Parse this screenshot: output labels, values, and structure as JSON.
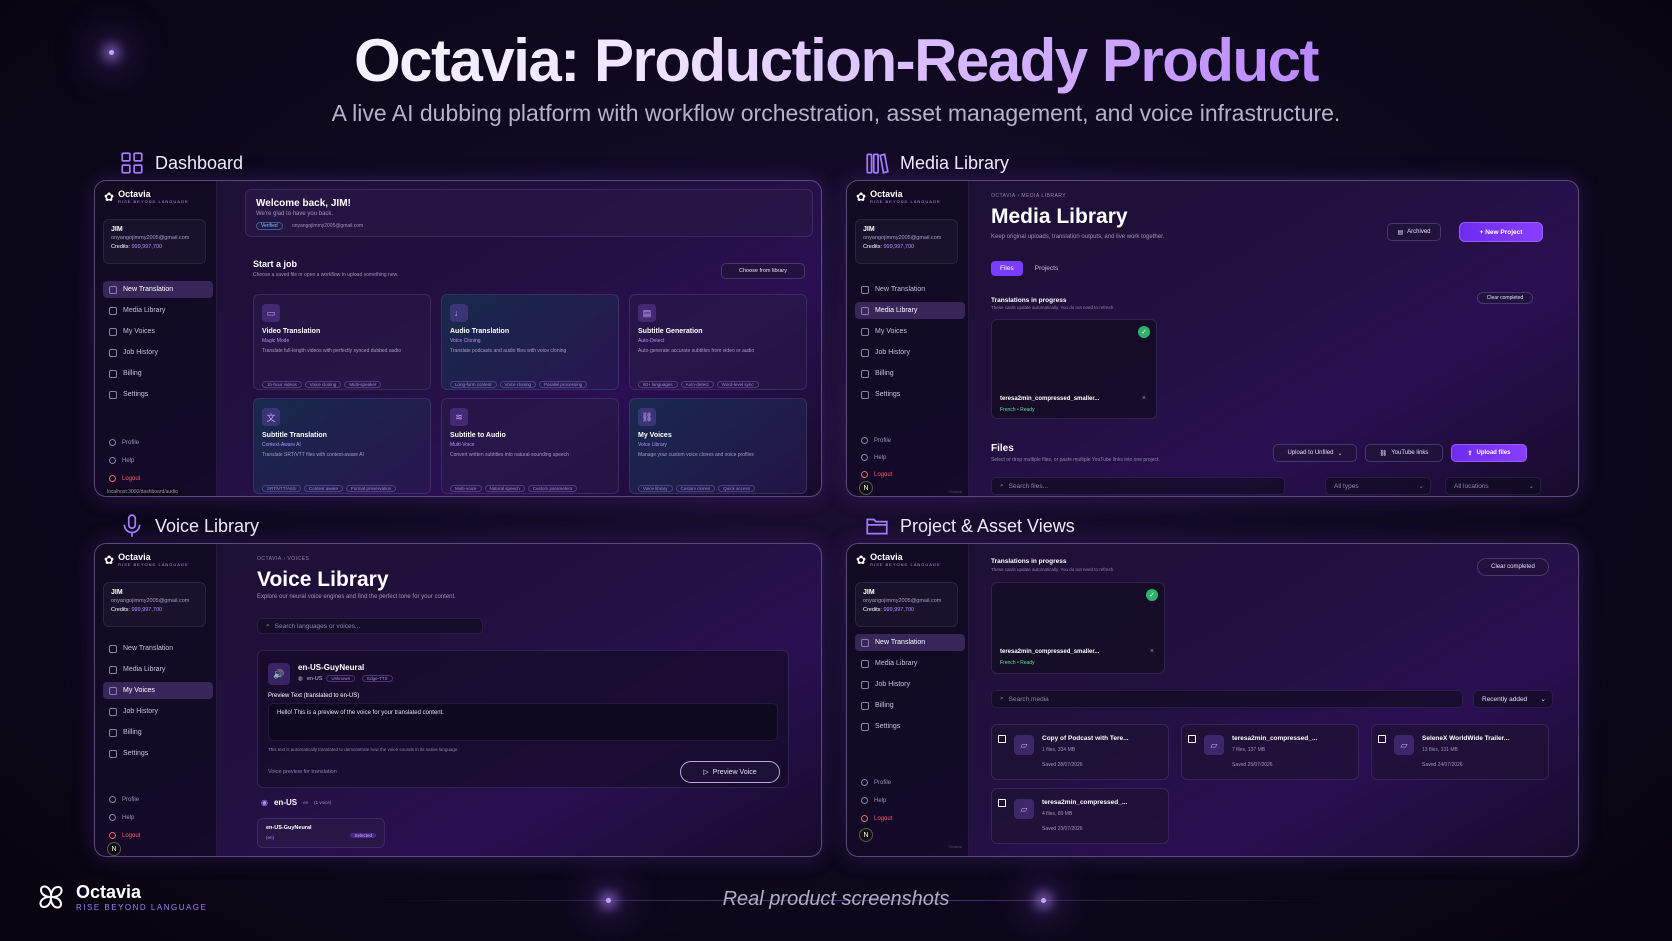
{
  "hero": {
    "title": "Octavia: Production-Ready Product",
    "subtitle": "A live AI dubbing platform with workflow orchestration, asset management, and voice infrastructure."
  },
  "sections": {
    "dashboard": "Dashboard",
    "media": "Media Library",
    "voice": "Voice Library",
    "project": "Project & Asset Views"
  },
  "brand": {
    "name": "Octavia",
    "tagline": "RISE BEYOND LANGUAGE"
  },
  "user": {
    "name": "JIM",
    "email": "onyangojimmy2005@gmail.com",
    "credits_label": "Credits:",
    "credits": "999,997,700"
  },
  "nav": [
    "New Translation",
    "Media Library",
    "My Voices",
    "Job History",
    "Billing",
    "Settings"
  ],
  "nav_footer": [
    "Profile",
    "Help",
    "Logout"
  ],
  "dashboard": {
    "welcome": "Welcome back, JIM!",
    "glad": "We're glad to have you back.",
    "verified": "Verified",
    "email": "onyangojimmy2005@gmail.com",
    "start_title": "Start a job",
    "start_sub": "Choose a saved file or open a workflow to upload something new.",
    "choose_btn": "Choose from library",
    "status_url": "localhost:3000/dashboard/audio",
    "cards": [
      {
        "title": "Video Translation",
        "mode": "Magic Mode",
        "desc": "Translate full-length videos with perfectly synced dubbed audio",
        "tags": [
          "1h-hour videos",
          "Voice cloning",
          "Multi-speaker"
        ]
      },
      {
        "title": "Audio Translation",
        "mode": "Voice Cloning",
        "desc": "Translate podcasts and audio files with voice cloning",
        "tags": [
          "Long-form content",
          "Voice cloning",
          "Parallel processing"
        ]
      },
      {
        "title": "Subtitle Generation",
        "mode": "Auto-Detect",
        "desc": "Auto-generate accurate subtitles from video or audio",
        "tags": [
          "80+ languages",
          "Auto-detect",
          "Word-level sync"
        ]
      },
      {
        "title": "Subtitle Translation",
        "mode": "Context-Aware AI",
        "desc": "Translate SRT/VTT files with context-aware AI",
        "tags": [
          "SRT/VTT/ASS",
          "Context aware",
          "Format preservation"
        ]
      },
      {
        "title": "Subtitle to Audio",
        "mode": "Multi-Voice",
        "desc": "Convert written subtitles into natural-sounding speech",
        "tags": [
          "Multi-voice",
          "Natural speech",
          "Custom parameters"
        ]
      },
      {
        "title": "My Voices",
        "mode": "Voice Library",
        "desc": "Manage your custom voice clones and voice profiles",
        "tags": [
          "Voice library",
          "Custom clones",
          "Quick access"
        ]
      }
    ]
  },
  "media": {
    "crumb1": "OCTAVIA",
    "crumb2": "MEDIA LIBRARY",
    "title": "Media Library",
    "subtitle": "Keep original uploads, translation outputs, and live work together.",
    "archived": "Archived",
    "new_project": "+ New Project",
    "tabs": [
      "Files",
      "Projects"
    ],
    "progress_title": "Translations in progress",
    "progress_sub": "These cards update automatically. You do not need to refresh.",
    "clear": "Clear completed",
    "job_name": "teresa2min_compressed_smaller...",
    "job_status": "French • Ready",
    "files_title": "Files",
    "files_sub": "Select or drop multiple files, or paste multiple YouTube links into one project.",
    "upload_to": "Upload to Unfiled",
    "youtube": "YouTube links",
    "upload_files": "Upload files",
    "search": "Search files...",
    "types": "All types",
    "locations": "All locations",
    "watermark": "Octavia"
  },
  "voice": {
    "crumb1": "OCTAVIA",
    "crumb2": "VOICES",
    "title": "Voice Library",
    "subtitle": "Explore our neural voice engines and find the perfect tone for your content.",
    "search": "Search languages or voices...",
    "voice_name": "en-US-GuyNeural",
    "locale": "en-US",
    "badge1": "Unknown",
    "badge2": "Edge-TTS",
    "preview_label": "Preview Text (translated to en-US)",
    "preview_text": "Hello! This is a preview of the voice for your translated content.",
    "note": "This text is automatically translated to demonstrate how the voice sounds in its native language.",
    "for_translation": "Voice preview for translation",
    "preview_btn": "Preview Voice",
    "group": "en-US",
    "group_code": "en",
    "group_count": "(1 voice)",
    "item": "en-US-GuyNeural",
    "item_sub": "(en)",
    "selected": "Selected"
  },
  "project": {
    "progress_title": "Translations in progress",
    "progress_sub": "These cards update automatically. You do not need to refresh.",
    "clear": "Clear completed",
    "job_name": "teresa2min_compressed_smaller...",
    "job_status": "French • Ready",
    "search": "Search media",
    "sort": "Recently added",
    "watermark": "Octavia",
    "items": [
      {
        "name": "Copy of Podcast with Tere...",
        "meta": "1 files, 334 MB",
        "saved": "Saved 28/07/2026"
      },
      {
        "name": "teresa2min_compressed_...",
        "meta": "7 files, 137 MB",
        "saved": "Saved 25/07/2026"
      },
      {
        "name": "SeleneX WorldWide Trailer...",
        "meta": "13 files, 131 MB",
        "saved": "Saved 24/07/2026"
      },
      {
        "name": "teresa2min_compressed_...",
        "meta": "4 files, 89 MB",
        "saved": "Saved 23/07/2026"
      }
    ]
  },
  "footer": {
    "caption": "Real product screenshots"
  },
  "colors": {
    "accent": "#8a3dff",
    "heading_gradient_end": "#9d5cff",
    "logout": "#ff5a6e",
    "ready": "#5ee08a"
  }
}
